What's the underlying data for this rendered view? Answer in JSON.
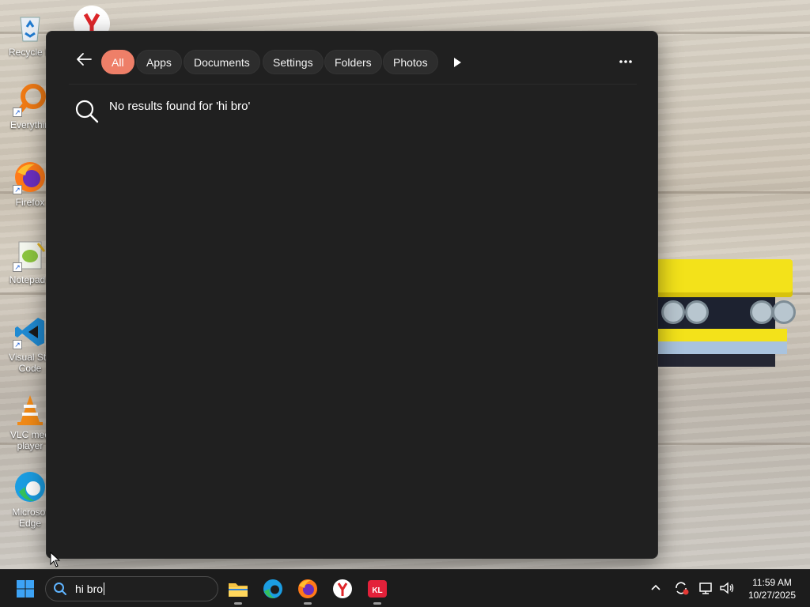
{
  "desktop": {
    "icons": [
      {
        "label": "Recycle Bin",
        "icon": "recycle-bin-icon"
      },
      {
        "label": "Everything",
        "icon": "everything-search-icon"
      },
      {
        "label": "Firefox",
        "icon": "firefox-icon"
      },
      {
        "label": "Notepad++",
        "icon": "notepad-plus-plus-icon"
      },
      {
        "label": "Visual Studio Code",
        "icon": "vscode-icon"
      },
      {
        "label": "VLC media player",
        "icon": "vlc-icon"
      },
      {
        "label": "Microsoft Edge",
        "icon": "edge-icon"
      }
    ],
    "visible_labels": [
      "Recycle B",
      "Everythin",
      "Firefox",
      "Notepad+",
      "Visual Stu",
      "Code",
      "VLC med",
      "player",
      "Microsof",
      "Edge"
    ]
  },
  "search_panel": {
    "filters": [
      "All",
      "Apps",
      "Documents",
      "Settings",
      "Folders",
      "Photos"
    ],
    "active_filter": "All",
    "no_results_text": "No results found for 'hi bro'"
  },
  "taskbar": {
    "search_value": "hi bro",
    "pinned_apps": [
      "File Explorer",
      "Microsoft Edge",
      "Firefox",
      "Yandex Browser",
      "Kaspersky"
    ],
    "clock": {
      "time": "11:59 AM",
      "date": "10/27/2025"
    }
  },
  "colors": {
    "accent": "#ee7f68",
    "panel_bg": "#202020",
    "taskbar_bg": "#1c1c1c"
  }
}
